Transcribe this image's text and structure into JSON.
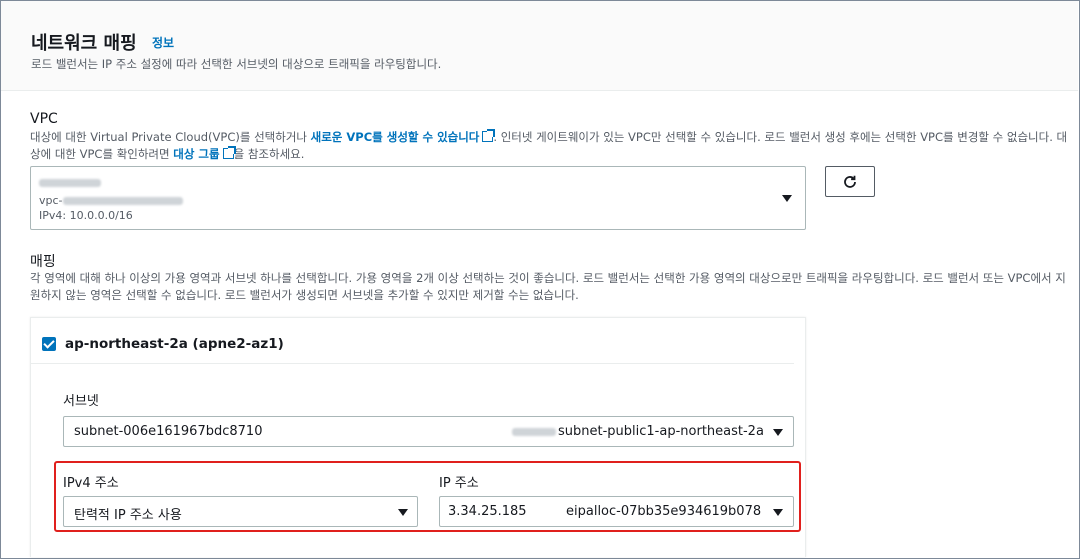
{
  "header": {
    "title": "네트워크 매핑",
    "info_link": "정보",
    "description": "로드 밸런서는 IP 주소 설정에 따라 선택한 서브넷의 대상으로 트래픽을 라우팅합니다."
  },
  "vpc": {
    "label": "VPC",
    "desc_part1": "대상에 대한 Virtual Private Cloud(VPC)를 선택하거나 ",
    "desc_link1": "새로운 VPC를 생성할 수 있습니다",
    "desc_part2": ". 인터넷 게이트웨이가 있는 VPC만 선택할 수 있습니다. 로드 밸런서 생성 후에는 선택한 VPC를 변경할 수 없습니다. 대상에 대한 VPC를 확인하려면 ",
    "desc_link2": "대상 그룹",
    "desc_part3": "을 참조하세요.",
    "selected_id_prefix": "vpc-",
    "selected_cidr": "IPv4: 10.0.0.0/16"
  },
  "mapping": {
    "label": "매핑",
    "description": "각 영역에 대해 하나 이상의 가용 영역과 서브넷 하나를 선택합니다. 가용 영역을 2개 이상 선택하는 것이 좋습니다. 로드 밸런서는 선택한 가용 영역의 대상으로만 트래픽을 라우팅합니다. 로드 밸런서 또는 VPC에서 지원하지 않는 영역은 선택할 수 없습니다. 로드 밸런서가 생성되면 서브넷을 추가할 수 있지만 제거할 수는 없습니다.",
    "zone": {
      "label": "ap-northeast-2a (apne2-az1)",
      "checked": true,
      "subnet_label": "서브넷",
      "subnet_id": "subnet-006e161967bdc8710",
      "subnet_name": "subnet-public1-ap-northeast-2a",
      "ipv4_label": "IPv4 주소",
      "ipv4_value": "탄력적 IP 주소 사용",
      "ip_label": "IP 주소",
      "ip_value": "3.34.25.185",
      "eip_alloc": "eipalloc-07bb35e934619b078"
    }
  },
  "colors": {
    "link": "#0073bb",
    "highlight": "#e0201d",
    "checkbox": "#0073bb"
  },
  "icons": [
    "external-link-icon",
    "refresh-icon",
    "caret-down-icon",
    "checkbox-checked-icon"
  ]
}
